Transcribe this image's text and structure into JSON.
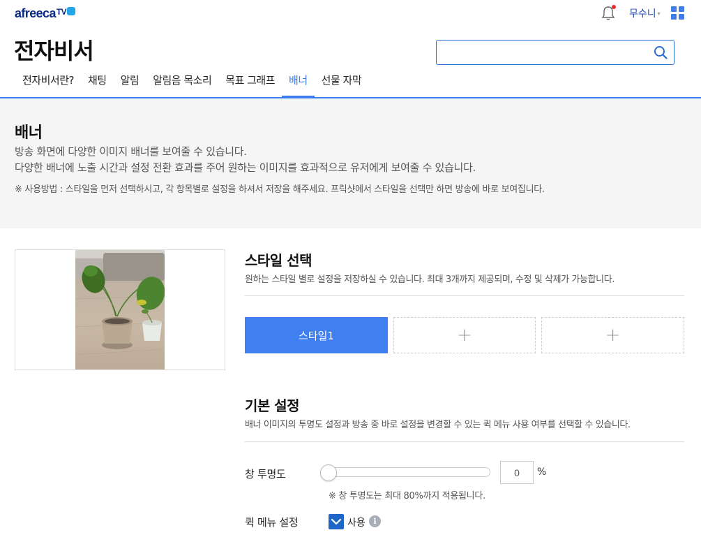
{
  "header": {
    "logo_text": "afreeca",
    "logo_tv": "TV",
    "user_name": "무수니",
    "user_caret": "▾"
  },
  "page": {
    "title": "전자비서"
  },
  "search": {
    "value": "",
    "placeholder": ""
  },
  "tabs": [
    {
      "label": "전자비서란?",
      "active": false
    },
    {
      "label": "채팅",
      "active": false
    },
    {
      "label": "알림",
      "active": false
    },
    {
      "label": "알림음 목소리",
      "active": false
    },
    {
      "label": "목표 그래프",
      "active": false
    },
    {
      "label": "배너",
      "active": true
    },
    {
      "label": "선물 자막",
      "active": false
    }
  ],
  "intro": {
    "title": "배너",
    "desc1": "방송 화면에 다양한 이미지 배너를 보여줄 수 있습니다.",
    "desc2": "다양한 배너에 노출 시간과 설정 전환 효과를 주어 원하는 이미지를 효과적으로 유저에게 보여줄 수 있습니다.",
    "note": "※ 사용방법 : 스타일을 먼저 선택하시고, 각 항목별로 설정을 하셔서 저장을 해주세요. 프릭샷에서 스타일을 선택만 하면 방송에 바로 보여집니다."
  },
  "style_section": {
    "title": "스타일 선택",
    "desc": "원하는 스타일 별로 설정을 저장하실 수 있습니다. 최대 3개까지 제공되며, 수정 및 삭제가 가능합니다.",
    "buttons": [
      {
        "label": "스타일1",
        "state": "selected"
      },
      {
        "label": "+",
        "state": "empty"
      },
      {
        "label": "+",
        "state": "empty"
      }
    ]
  },
  "basic_section": {
    "title": "기본 설정",
    "desc": "배너 이미지의 투명도 설정과 방송 중 바로 설정을 변경할 수 있는 퀵 메뉴 사용 여부를 선택할 수 있습니다.",
    "opacity": {
      "label": "창 투명도",
      "value": "0",
      "unit": "%",
      "hint": "※ 창 투명도는 최대 80%까지 적용됩니다."
    },
    "quick_menu": {
      "label": "퀵 메뉴 설정",
      "checked": true,
      "option_label": "사용",
      "info": "i"
    }
  },
  "colors": {
    "accent": "#3b7ded",
    "brand": "#0d2c86",
    "checkbox": "#1e66c7"
  }
}
